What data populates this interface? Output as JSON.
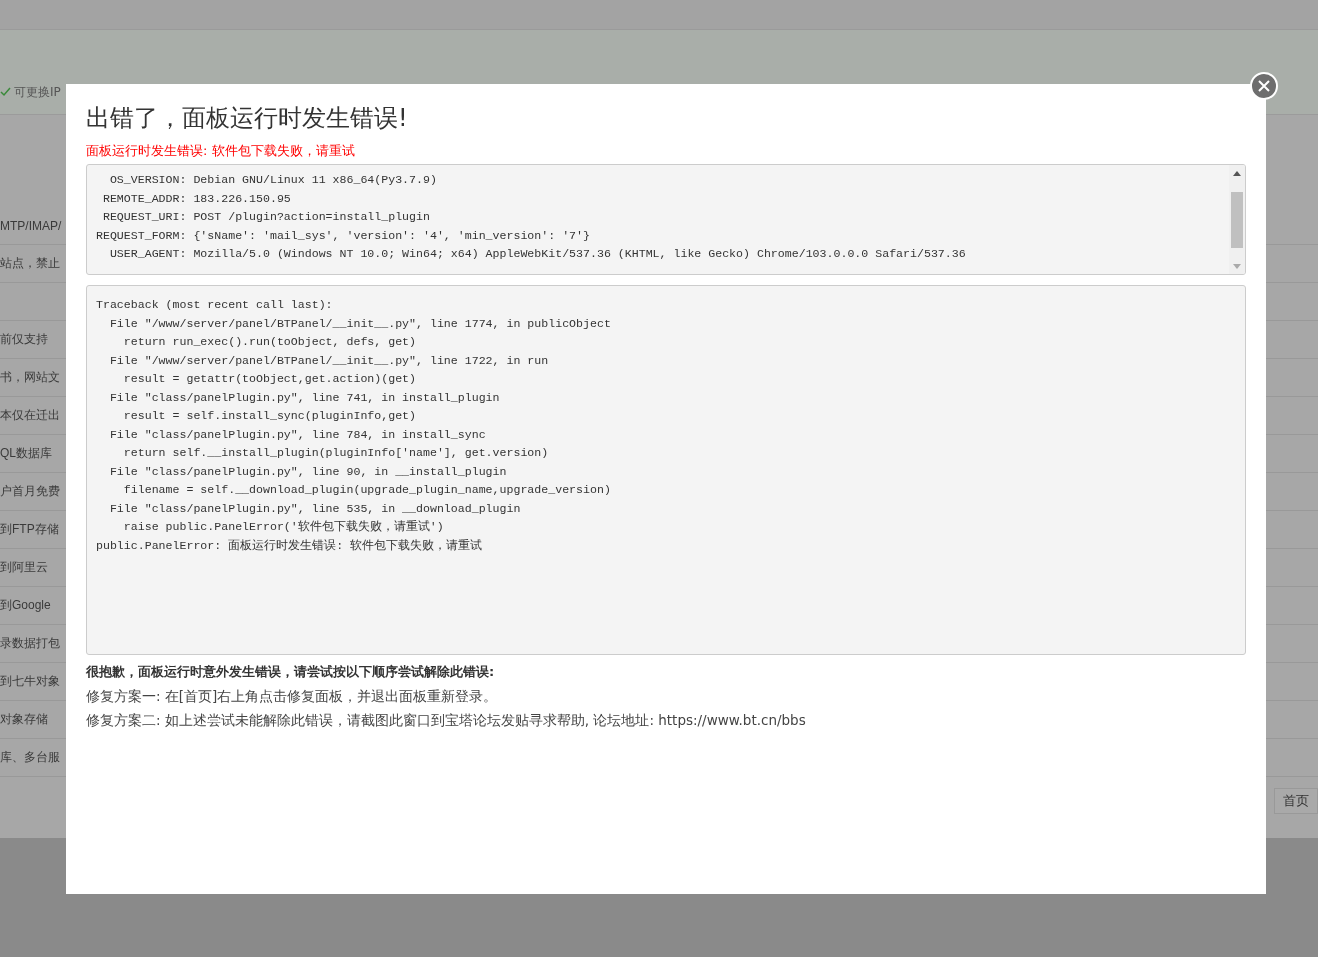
{
  "background": {
    "ip_note": "可更换IP",
    "rows": [
      "MTP/IMAP/",
      "站点，禁止",
      "",
      "前仅支持",
      "书，网站文",
      "本仅在迁出",
      "QL数据库",
      "户首月免费",
      "到FTP存储",
      "到阿里云",
      "到Google",
      "录数据打包",
      "到七牛对象",
      "对象存储",
      "库、多台服"
    ],
    "pager_button": "首页"
  },
  "dialog": {
    "title": "出错了，面板运行时发生错误!",
    "error_summary": "面板运行时发生错误: 软件包下载失败，请重试",
    "environment_lines": [
      "  OS_VERSION: Debian GNU/Linux 11 x86_64(Py3.7.9)",
      " REMOTE_ADDR: 183.226.150.95",
      " REQUEST_URI: POST /plugin?action=install_plugin",
      "REQUEST_FORM: {'sName': 'mail_sys', 'version': '4', 'min_version': '7'}",
      "  USER_AGENT: Mozilla/5.0 (Windows NT 10.0; Win64; x64) AppleWebKit/537.36 (KHTML, like Gecko) Chrome/103.0.0.0 Safari/537.36"
    ],
    "traceback_lines": [
      "Traceback (most recent call last):",
      "  File \"/www/server/panel/BTPanel/__init__.py\", line 1774, in publicObject",
      "    return run_exec().run(toObject, defs, get)",
      "  File \"/www/server/panel/BTPanel/__init__.py\", line 1722, in run",
      "    result = getattr(toObject,get.action)(get)",
      "  File \"class/panelPlugin.py\", line 741, in install_plugin",
      "    result = self.install_sync(pluginInfo,get)",
      "  File \"class/panelPlugin.py\", line 784, in install_sync",
      "    return self.__install_plugin(pluginInfo['name'], get.version)",
      "  File \"class/panelPlugin.py\", line 90, in __install_plugin",
      "    filename = self.__download_plugin(upgrade_plugin_name,upgrade_version)",
      "  File \"class/panelPlugin.py\", line 535, in __download_plugin",
      "    raise public.PanelError('软件包下载失败，请重试')",
      "public.PanelError: 面板运行时发生错误: 软件包下载失败，请重试"
    ],
    "help_heading": "很抱歉，面板运行时意外发生错误，请尝试按以下顺序尝试解除此错误:",
    "help_lines": [
      "修复方案一: 在[首页]右上角点击修复面板，并退出面板重新登录。",
      "修复方案二: 如上述尝试未能解除此错误，请截图此窗口到宝塔论坛发贴寻求帮助, 论坛地址: https://www.bt.cn/bbs"
    ]
  }
}
